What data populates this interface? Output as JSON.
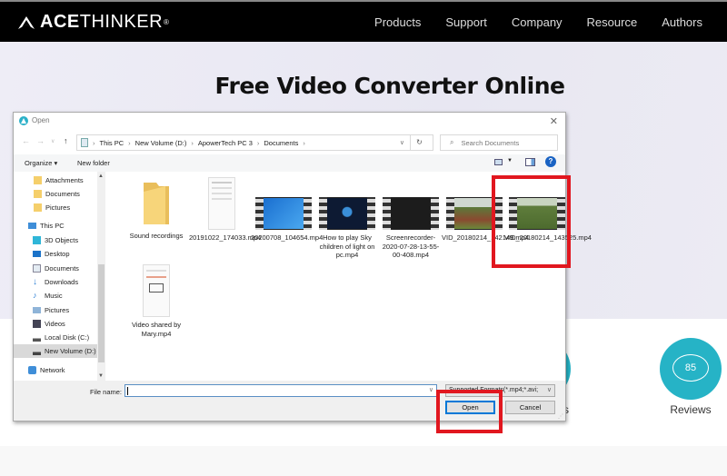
{
  "site": {
    "brand_bold": "ACE",
    "brand_thin": "THINKER",
    "brand_mark": "®",
    "nav": [
      "Products",
      "Support",
      "Company",
      "Resource",
      "Authors"
    ],
    "hero_title": "Free Video Converter Online",
    "stats": {
      "reviews_count": "85",
      "reviews_label": "Reviews",
      "partial_label": "s"
    },
    "accent_color": "#26b3c6"
  },
  "dialog": {
    "title": "Open",
    "breadcrumb": [
      "This PC",
      "New Volume (D:)",
      "ApowerTech PC 3",
      "Documents"
    ],
    "search_placeholder": "Search Documents",
    "toolbar": {
      "organize": "Organize ▾",
      "new_folder": "New folder",
      "help": "?"
    },
    "sidebar": [
      {
        "label": "Attachments",
        "icon": "folder-icon"
      },
      {
        "label": "Documents",
        "icon": "folder-icon"
      },
      {
        "label": "Pictures",
        "icon": "folder-icon"
      },
      {
        "label": "This PC",
        "icon": "computer-icon"
      },
      {
        "label": "3D Objects",
        "icon": "cube-icon"
      },
      {
        "label": "Desktop",
        "icon": "desktop-icon"
      },
      {
        "label": "Documents",
        "icon": "document-icon"
      },
      {
        "label": "Downloads",
        "icon": "download-icon"
      },
      {
        "label": "Music",
        "icon": "music-icon"
      },
      {
        "label": "Pictures",
        "icon": "picture-icon"
      },
      {
        "label": "Videos",
        "icon": "video-icon"
      },
      {
        "label": "Local Disk (C:)",
        "icon": "drive-icon"
      },
      {
        "label": "New Volume (D:)",
        "icon": "drive-icon",
        "selected": true
      },
      {
        "label": "Network",
        "icon": "network-icon"
      }
    ],
    "files": [
      {
        "name": "Sound recordings",
        "type": "folder"
      },
      {
        "name": "20191022_174033.mp4",
        "type": "phone-video"
      },
      {
        "name": "20200708_104654.mp4",
        "type": "video"
      },
      {
        "name": "How to play Sky children of light on pc.mp4",
        "type": "video"
      },
      {
        "name": "Screenrecorder-2020-07-28-13-55-00-408.mp4",
        "type": "video"
      },
      {
        "name": "VID_20180214_142149.mp4",
        "type": "video"
      },
      {
        "name": "VID_20180214_143525.mp4",
        "type": "video",
        "highlighted": true
      },
      {
        "name": "Video shared by Mary.mp4",
        "type": "phone-video"
      }
    ],
    "file_name_label": "File name:",
    "file_name_value": "",
    "filter_value": "Supported Formats(*.mp4;*.avi;",
    "open_label": "Open",
    "cancel_label": "Cancel"
  }
}
